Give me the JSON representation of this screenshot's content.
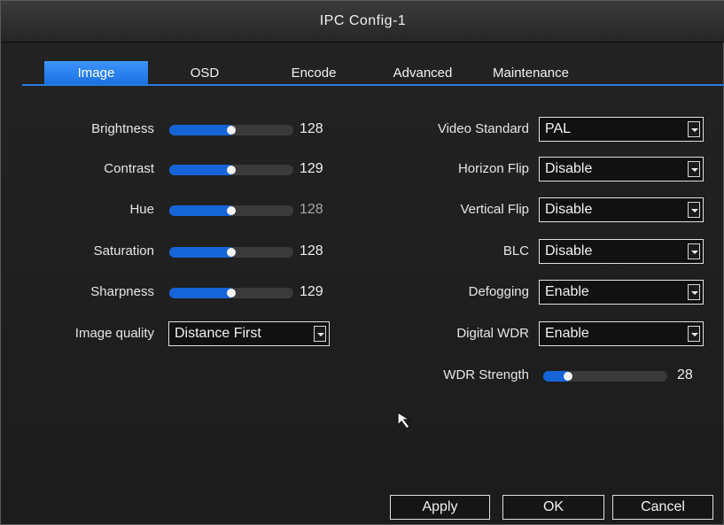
{
  "window": {
    "title": "IPC Config-1"
  },
  "tabs": [
    {
      "label": "Image",
      "active": true
    },
    {
      "label": "OSD",
      "active": false
    },
    {
      "label": "Encode",
      "active": false
    },
    {
      "label": "Advanced",
      "active": false
    },
    {
      "label": "Maintenance",
      "active": false
    }
  ],
  "image_settings": {
    "brightness": {
      "label": "Brightness",
      "value": "128",
      "level": 0.5
    },
    "contrast": {
      "label": "Contrast",
      "value": "129",
      "level": 0.5
    },
    "hue": {
      "label": "Hue",
      "value": "128",
      "level": 0.5
    },
    "saturation": {
      "label": "Saturation",
      "value": "128",
      "level": 0.5
    },
    "sharpness": {
      "label": "Sharpness",
      "value": "129",
      "level": 0.5
    },
    "image_quality": {
      "label": "Image quality",
      "value": "Distance First"
    }
  },
  "video_settings": {
    "video_standard": {
      "label": "Video Standard",
      "value": "PAL"
    },
    "horizon_flip": {
      "label": "Horizon Flip",
      "value": "Disable"
    },
    "vertical_flip": {
      "label": "Vertical Flip",
      "value": "Disable"
    },
    "blc": {
      "label": "BLC",
      "value": "Disable"
    },
    "defogging": {
      "label": "Defogging",
      "value": "Enable"
    },
    "digital_wdr": {
      "label": "Digital WDR",
      "value": "Enable"
    },
    "wdr_strength": {
      "label": "WDR Strength",
      "value": "28",
      "level": 0.2
    }
  },
  "buttons": {
    "apply": "Apply",
    "ok": "OK",
    "cancel": "Cancel"
  },
  "icons": {
    "dropdown": "chevron-down-icon",
    "cursor": "mouse-pointer-icon"
  },
  "colors": {
    "accent": "#1a6fe0",
    "slider_fill": "#1565d8",
    "background": "#1f1f1f"
  }
}
